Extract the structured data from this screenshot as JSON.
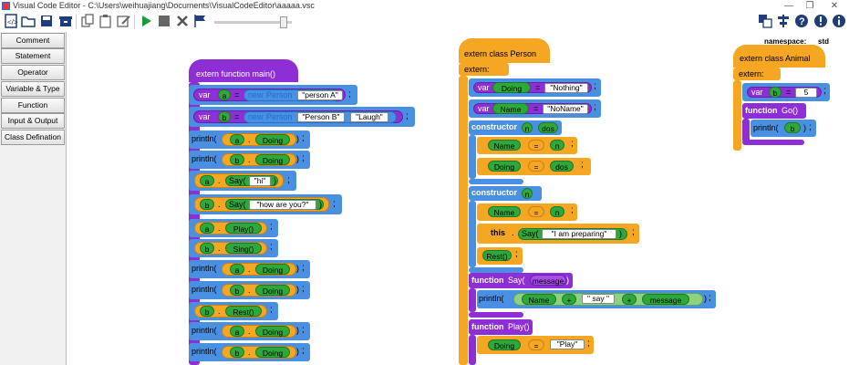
{
  "window": {
    "title": "Visual Code Editor - C:\\Users\\weihuajiang\\Documents\\VisualCodeEditor\\aaaaa.vsc",
    "minimize": "—",
    "restore": "❐",
    "close": "✕"
  },
  "toolbar": {
    "icons": [
      "new-file-icon",
      "open-folder-icon",
      "save-icon",
      "archive-icon",
      "copy-icon",
      "paste-icon",
      "edit-icon",
      "run-icon",
      "stop-icon",
      "clear-icon",
      "flag-icon",
      "translate-icon",
      "align-icon",
      "help-icon",
      "warning-icon",
      "info-icon"
    ]
  },
  "sidebar": {
    "items": [
      "Comment",
      "Statement",
      "Operator",
      "Variable & Type",
      "Function",
      "Input & Output",
      "Class Defination"
    ]
  },
  "main_func": {
    "header": "extern function main()",
    "lines": [
      {
        "type": "var",
        "kw": "var",
        "name": "a",
        "eq": "=",
        "new": "new",
        "cls": "Person",
        "args": [
          "\"person A\""
        ]
      },
      {
        "type": "var",
        "kw": "var",
        "name": "b",
        "eq": "=",
        "new": "new",
        "cls": "Person",
        "args": [
          "\"Person B\"",
          "\"Laugh\""
        ]
      },
      {
        "type": "println",
        "fn": "println(",
        "obj": "a",
        "dot": ".",
        "member": "Doing",
        "close": ")"
      },
      {
        "type": "println",
        "fn": "println(",
        "obj": "b",
        "dot": ".",
        "member": "Doing",
        "close": ")"
      },
      {
        "type": "call",
        "obj": "a",
        "dot": ".",
        "method": "Say(",
        "arg": "\"hi\"",
        "close": ")"
      },
      {
        "type": "call",
        "obj": "b",
        "dot": ".",
        "method": "Say(",
        "arg": "\"how are you?\"",
        "close": ")"
      },
      {
        "type": "call0",
        "obj": "a",
        "dot": ".",
        "method": "Play()"
      },
      {
        "type": "call0",
        "obj": "b",
        "dot": ".",
        "method": "Sing()"
      },
      {
        "type": "println",
        "fn": "println(",
        "obj": "a",
        "dot": ".",
        "member": "Doing",
        "close": ")"
      },
      {
        "type": "println",
        "fn": "println(",
        "obj": "b",
        "dot": ".",
        "member": "Doing",
        "close": ")"
      },
      {
        "type": "call0",
        "obj": "b",
        "dot": ".",
        "method": "Rest()"
      },
      {
        "type": "println",
        "fn": "println(",
        "obj": "a",
        "dot": ".",
        "member": "Doing",
        "close": ")"
      },
      {
        "type": "println",
        "fn": "println(",
        "obj": "b",
        "dot": ".",
        "member": "Doing",
        "close": ")"
      }
    ]
  },
  "person_class": {
    "header": "extern class Person",
    "extern_label": "extern:",
    "var1": {
      "kw": "var",
      "name": "Doing",
      "eq": "=",
      "value": "\"Nothing\""
    },
    "var2": {
      "kw": "var",
      "name": "Name",
      "eq": "=",
      "value": "\"NoName\""
    },
    "ctor1": {
      "kw": "constructor",
      "params": [
        "n",
        "dos"
      ],
      "assigns": [
        {
          "target": "Name",
          "eq": "=",
          "val": "n"
        },
        {
          "target": "Doing",
          "eq": "=",
          "val": "dos"
        }
      ]
    },
    "ctor2": {
      "kw": "constructor",
      "params": [
        "n"
      ],
      "assign": {
        "target": "Name",
        "eq": "=",
        "val": "n"
      },
      "call": {
        "this": "this",
        "dot": ".",
        "method": "Say(",
        "arg": "\"I am preparing\"",
        "close": ")"
      },
      "rest": "Rest()"
    },
    "fn_say": {
      "kw": "function",
      "name": "Say(",
      "param": "message",
      "close": ")",
      "body": {
        "fn": "println(",
        "name": "Name",
        "plus1": "+",
        "str": "\" say \"",
        "plus2": "+",
        "msg": "message",
        "close": ")"
      }
    },
    "fn_play": {
      "kw": "function",
      "name": "Play()",
      "body": {
        "target": "Doing",
        "eq": "=",
        "val": "\"Play\""
      }
    }
  },
  "animal_class": {
    "namespace_label": "namespace:",
    "namespace_value": "std",
    "header": "extern class Animal",
    "extern_label": "extern:",
    "var": {
      "kw": "var",
      "name": "b",
      "eq": "=",
      "value": "5"
    },
    "fn_go": {
      "kw": "function",
      "name": "Go()",
      "body": {
        "fn": "println(",
        "arg": "b",
        "close": ")"
      }
    }
  },
  "semicolon": ";"
}
